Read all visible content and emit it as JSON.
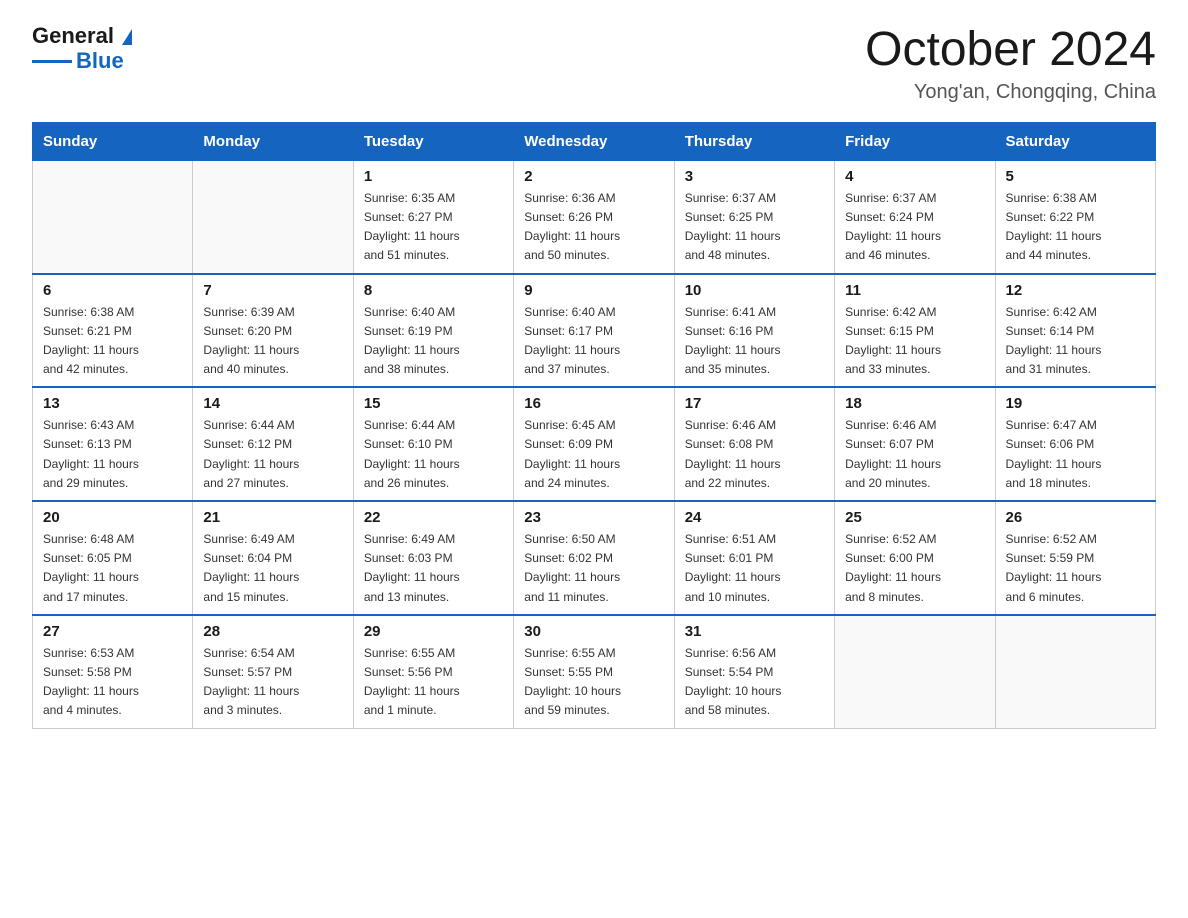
{
  "header": {
    "logo_general": "General",
    "logo_triangle": "▶",
    "logo_blue": "Blue",
    "main_title": "October 2024",
    "subtitle": "Yong'an, Chongqing, China"
  },
  "days_of_week": [
    "Sunday",
    "Monday",
    "Tuesday",
    "Wednesday",
    "Thursday",
    "Friday",
    "Saturday"
  ],
  "weeks": [
    [
      {
        "day": "",
        "info": ""
      },
      {
        "day": "",
        "info": ""
      },
      {
        "day": "1",
        "info": "Sunrise: 6:35 AM\nSunset: 6:27 PM\nDaylight: 11 hours\nand 51 minutes."
      },
      {
        "day": "2",
        "info": "Sunrise: 6:36 AM\nSunset: 6:26 PM\nDaylight: 11 hours\nand 50 minutes."
      },
      {
        "day": "3",
        "info": "Sunrise: 6:37 AM\nSunset: 6:25 PM\nDaylight: 11 hours\nand 48 minutes."
      },
      {
        "day": "4",
        "info": "Sunrise: 6:37 AM\nSunset: 6:24 PM\nDaylight: 11 hours\nand 46 minutes."
      },
      {
        "day": "5",
        "info": "Sunrise: 6:38 AM\nSunset: 6:22 PM\nDaylight: 11 hours\nand 44 minutes."
      }
    ],
    [
      {
        "day": "6",
        "info": "Sunrise: 6:38 AM\nSunset: 6:21 PM\nDaylight: 11 hours\nand 42 minutes."
      },
      {
        "day": "7",
        "info": "Sunrise: 6:39 AM\nSunset: 6:20 PM\nDaylight: 11 hours\nand 40 minutes."
      },
      {
        "day": "8",
        "info": "Sunrise: 6:40 AM\nSunset: 6:19 PM\nDaylight: 11 hours\nand 38 minutes."
      },
      {
        "day": "9",
        "info": "Sunrise: 6:40 AM\nSunset: 6:17 PM\nDaylight: 11 hours\nand 37 minutes."
      },
      {
        "day": "10",
        "info": "Sunrise: 6:41 AM\nSunset: 6:16 PM\nDaylight: 11 hours\nand 35 minutes."
      },
      {
        "day": "11",
        "info": "Sunrise: 6:42 AM\nSunset: 6:15 PM\nDaylight: 11 hours\nand 33 minutes."
      },
      {
        "day": "12",
        "info": "Sunrise: 6:42 AM\nSunset: 6:14 PM\nDaylight: 11 hours\nand 31 minutes."
      }
    ],
    [
      {
        "day": "13",
        "info": "Sunrise: 6:43 AM\nSunset: 6:13 PM\nDaylight: 11 hours\nand 29 minutes."
      },
      {
        "day": "14",
        "info": "Sunrise: 6:44 AM\nSunset: 6:12 PM\nDaylight: 11 hours\nand 27 minutes."
      },
      {
        "day": "15",
        "info": "Sunrise: 6:44 AM\nSunset: 6:10 PM\nDaylight: 11 hours\nand 26 minutes."
      },
      {
        "day": "16",
        "info": "Sunrise: 6:45 AM\nSunset: 6:09 PM\nDaylight: 11 hours\nand 24 minutes."
      },
      {
        "day": "17",
        "info": "Sunrise: 6:46 AM\nSunset: 6:08 PM\nDaylight: 11 hours\nand 22 minutes."
      },
      {
        "day": "18",
        "info": "Sunrise: 6:46 AM\nSunset: 6:07 PM\nDaylight: 11 hours\nand 20 minutes."
      },
      {
        "day": "19",
        "info": "Sunrise: 6:47 AM\nSunset: 6:06 PM\nDaylight: 11 hours\nand 18 minutes."
      }
    ],
    [
      {
        "day": "20",
        "info": "Sunrise: 6:48 AM\nSunset: 6:05 PM\nDaylight: 11 hours\nand 17 minutes."
      },
      {
        "day": "21",
        "info": "Sunrise: 6:49 AM\nSunset: 6:04 PM\nDaylight: 11 hours\nand 15 minutes."
      },
      {
        "day": "22",
        "info": "Sunrise: 6:49 AM\nSunset: 6:03 PM\nDaylight: 11 hours\nand 13 minutes."
      },
      {
        "day": "23",
        "info": "Sunrise: 6:50 AM\nSunset: 6:02 PM\nDaylight: 11 hours\nand 11 minutes."
      },
      {
        "day": "24",
        "info": "Sunrise: 6:51 AM\nSunset: 6:01 PM\nDaylight: 11 hours\nand 10 minutes."
      },
      {
        "day": "25",
        "info": "Sunrise: 6:52 AM\nSunset: 6:00 PM\nDaylight: 11 hours\nand 8 minutes."
      },
      {
        "day": "26",
        "info": "Sunrise: 6:52 AM\nSunset: 5:59 PM\nDaylight: 11 hours\nand 6 minutes."
      }
    ],
    [
      {
        "day": "27",
        "info": "Sunrise: 6:53 AM\nSunset: 5:58 PM\nDaylight: 11 hours\nand 4 minutes."
      },
      {
        "day": "28",
        "info": "Sunrise: 6:54 AM\nSunset: 5:57 PM\nDaylight: 11 hours\nand 3 minutes."
      },
      {
        "day": "29",
        "info": "Sunrise: 6:55 AM\nSunset: 5:56 PM\nDaylight: 11 hours\nand 1 minute."
      },
      {
        "day": "30",
        "info": "Sunrise: 6:55 AM\nSunset: 5:55 PM\nDaylight: 10 hours\nand 59 minutes."
      },
      {
        "day": "31",
        "info": "Sunrise: 6:56 AM\nSunset: 5:54 PM\nDaylight: 10 hours\nand 58 minutes."
      },
      {
        "day": "",
        "info": ""
      },
      {
        "day": "",
        "info": ""
      }
    ]
  ]
}
